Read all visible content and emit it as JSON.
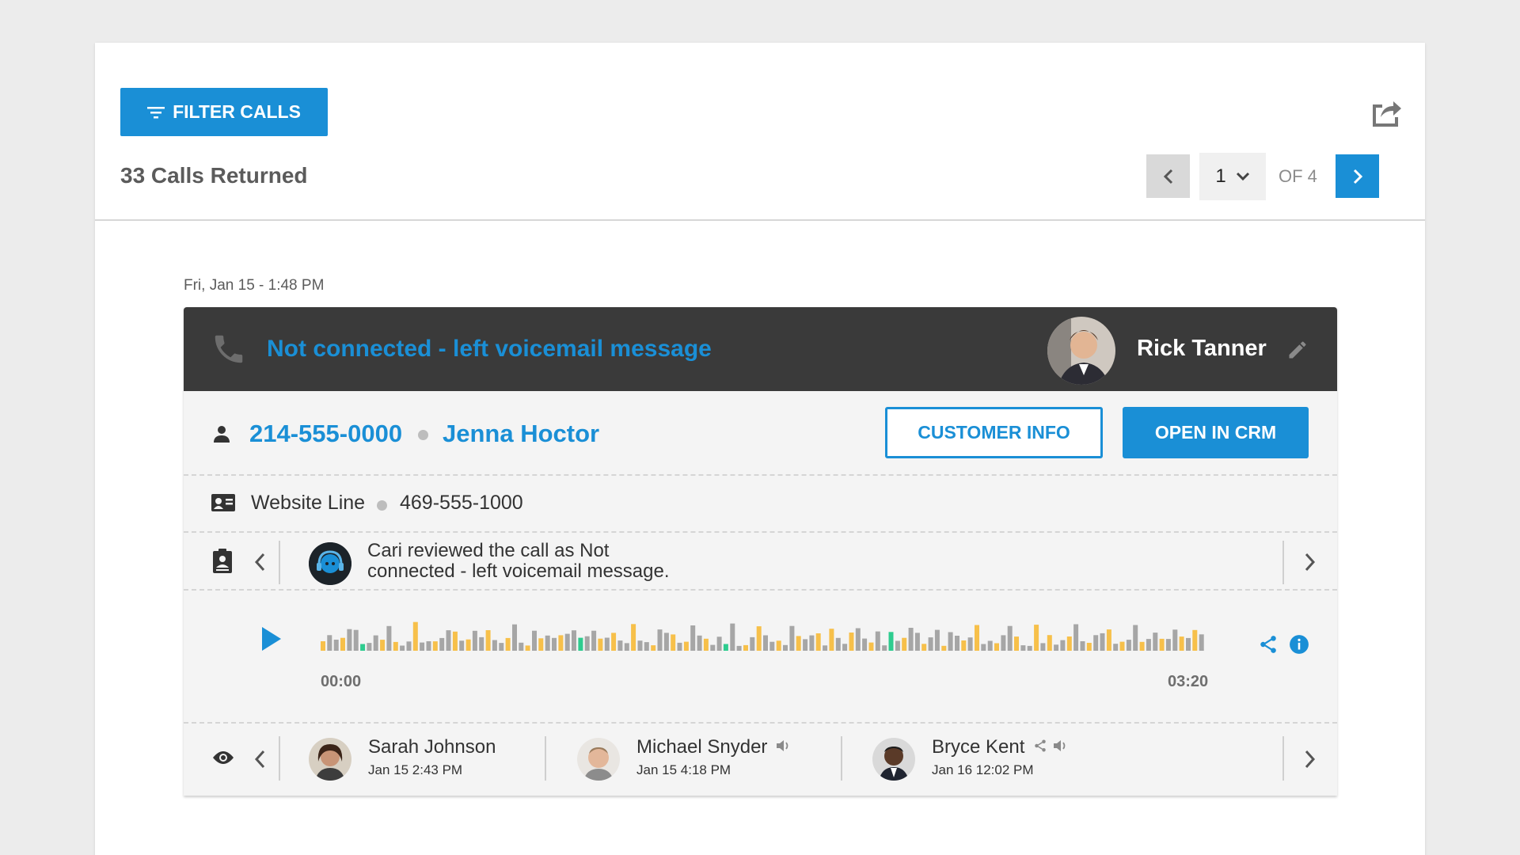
{
  "toolbar": {
    "filter_label": "FILTER CALLS",
    "export_icon": "export-icon"
  },
  "results": {
    "count_text": "33 Calls Returned"
  },
  "pagination": {
    "current_page": "1",
    "of_text": "OF 4"
  },
  "call": {
    "date_text": "Fri, Jan 15 - 1:48 PM",
    "disposition": "Not connected - left voicemail message",
    "agent_name": "Rick Tanner",
    "caller_number": "214-555-0000",
    "caller_name": "Jenna Hoctor",
    "customer_info_label": "CUSTOMER INFO",
    "open_crm_label": "OPEN IN CRM",
    "line_name": "Website Line",
    "line_number": "469-555-1000",
    "review_text": "Cari reviewed the call as Not connected - left voicemail message.",
    "audio": {
      "start_time": "00:00",
      "end_time": "03:20"
    },
    "viewers": [
      {
        "name": "Sarah Johnson",
        "date": "Jan 15 2:43 PM"
      },
      {
        "name": "Michael Snyder",
        "date": "Jan 15 4:18 PM"
      },
      {
        "name": "Bryce Kent",
        "date": "Jan 16 12:02 PM"
      }
    ]
  },
  "colors": {
    "accent": "#1a8fd6",
    "header_dark": "#3a3a3a",
    "wave_gray": "#a6a6a6",
    "wave_yellow": "#f7c04a",
    "wave_green": "#2ecc8f"
  }
}
